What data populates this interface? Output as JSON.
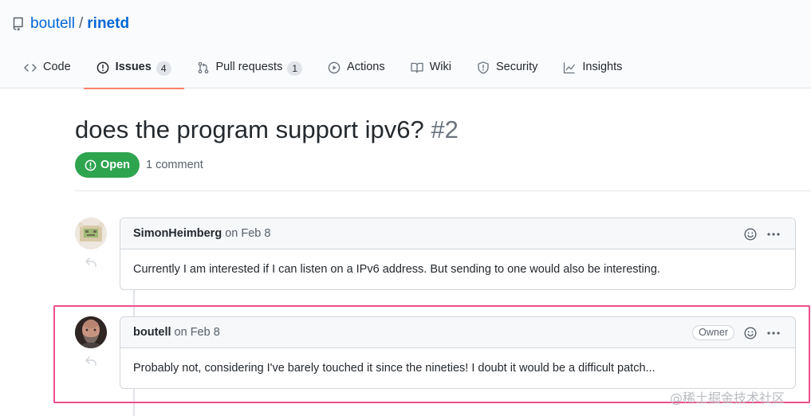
{
  "repo": {
    "owner": "boutell",
    "separator": "/",
    "name": "rinetd"
  },
  "tabs": [
    {
      "label": "Code",
      "icon": "code-icon"
    },
    {
      "label": "Issues",
      "icon": "issue-opened-icon",
      "count": "4"
    },
    {
      "label": "Pull requests",
      "icon": "git-pull-request-icon",
      "count": "1"
    },
    {
      "label": "Actions",
      "icon": "play-icon"
    },
    {
      "label": "Wiki",
      "icon": "book-icon"
    },
    {
      "label": "Security",
      "icon": "shield-icon"
    },
    {
      "label": "Insights",
      "icon": "graph-icon"
    }
  ],
  "selected_tab": "Issues",
  "issue": {
    "title": "does the program support ipv6?",
    "number": "#2",
    "state": "Open",
    "comment_count": "1 comment"
  },
  "comments": [
    {
      "author": "SimonHeimberg",
      "date": "on Feb 8",
      "body": "Currently I am interested if I can listen on a IPv6 address. But sending to one would also be interesting."
    },
    {
      "author": "boutell",
      "date": "on Feb 8",
      "label": "Owner",
      "body": "Probably not, considering I've barely touched it since the nineties! I doubt it would be a difficult patch..."
    }
  ],
  "watermark": "@稀土掘金技术社区",
  "colors": {
    "link": "#0366d6",
    "open_green": "#2ea44f",
    "tab_underline": "#f9826c",
    "highlight_box": "#ec4f8f"
  }
}
